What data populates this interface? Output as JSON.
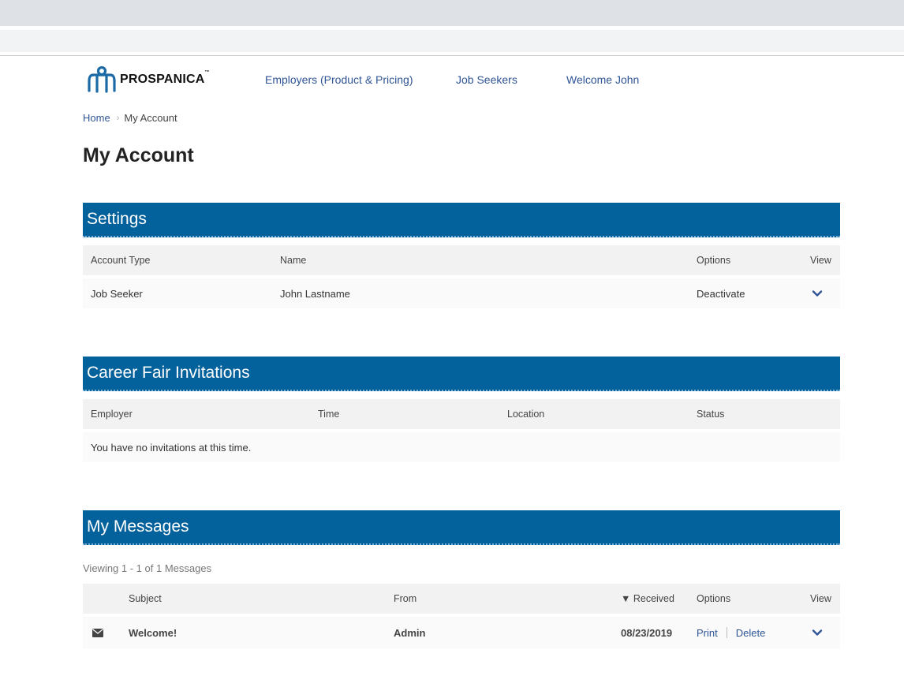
{
  "brand": {
    "logo_text": "PROSPANICA",
    "trademark": "™"
  },
  "nav": {
    "employers": "Employers (Product & Pricing)",
    "job_seekers": "Job Seekers",
    "welcome": "Welcome John"
  },
  "breadcrumb": {
    "home": "Home",
    "separator": "›",
    "current": "My Account"
  },
  "page_title": "My Account",
  "settings": {
    "title": "Settings",
    "headers": {
      "account_type": "Account Type",
      "name": "Name",
      "options": "Options",
      "view": "View"
    },
    "row": {
      "account_type": "Job Seeker",
      "name": "John Lastname",
      "option": "Deactivate"
    }
  },
  "career_fair": {
    "title": "Career Fair Invitations",
    "headers": {
      "employer": "Employer",
      "time": "Time",
      "location": "Location",
      "status": "Status"
    },
    "empty_message": "You have no invitations at this time."
  },
  "messages": {
    "title": "My Messages",
    "viewing": "Viewing 1 - 1 of 1 Messages",
    "headers": {
      "subject": "Subject",
      "from": "From",
      "received": "▼ Received",
      "options": "Options",
      "view": "View"
    },
    "row": {
      "subject": "Welcome!",
      "from": "Admin",
      "received": "08/23/2019",
      "print": "Print",
      "delete": "Delete"
    }
  },
  "colors": {
    "accent": "#03619c",
    "link": "#2f5597"
  },
  "icons": [
    "prospanica-logo-icon",
    "chevron-down-icon",
    "envelope-icon"
  ]
}
